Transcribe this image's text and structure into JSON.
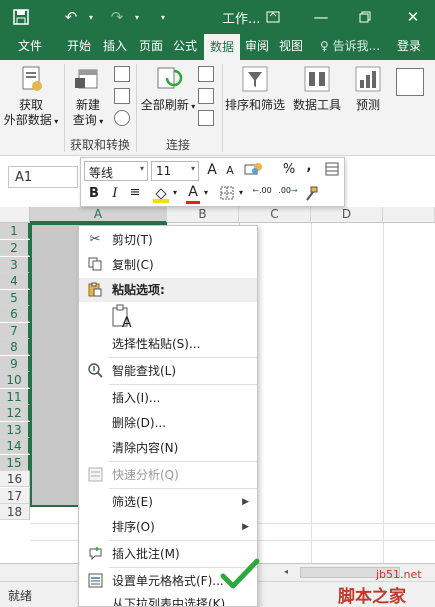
{
  "titlebar": {
    "title": "工作...",
    "save_icon": "save-icon",
    "undo_icon": "undo-icon",
    "redo_icon": "redo-icon"
  },
  "tabs": [
    {
      "label": "文件"
    },
    {
      "label": "开始"
    },
    {
      "label": "插入"
    },
    {
      "label": "页面"
    },
    {
      "label": "公式"
    },
    {
      "label": "数据"
    },
    {
      "label": "审阅"
    },
    {
      "label": "视图"
    },
    {
      "label": "告诉我..."
    },
    {
      "label": "登录"
    }
  ],
  "ribbon": {
    "get_external": "获取\n外部数据",
    "get_external_l1": "获取",
    "get_external_l2": "外部数据",
    "new_query_l1": "新建",
    "new_query_l2": "查询",
    "refresh_all": "全部刷新",
    "sort_filter": "排序和筛选",
    "data_tools": "数据工具",
    "forecast": "预测",
    "group_get_transform": "获取和转换",
    "group_connections": "连接"
  },
  "namebox": {
    "value": "A1"
  },
  "mini_toolbar": {
    "font_name": "等线",
    "font_size": "11",
    "grow_font": "A",
    "shrink_font": "A",
    "percent": "%",
    "comma": ",",
    "bold": "B",
    "italic": "I",
    "align": "≡",
    "increase_decimal": ".00",
    "decrease_decimal": ".00"
  },
  "grid": {
    "columns": [
      "A",
      "B",
      "C",
      "D"
    ],
    "rows": [
      "1",
      "2",
      "3",
      "4",
      "5",
      "6",
      "7",
      "8",
      "9",
      "10",
      "11",
      "12",
      "13",
      "14",
      "15",
      "16",
      "17",
      "18"
    ]
  },
  "context_menu": {
    "items": [
      {
        "label": "剪切(T)",
        "icon": "scissors-icon"
      },
      {
        "label": "复制(C)",
        "icon": "copy-icon"
      },
      {
        "label": "粘贴选项:",
        "icon": "clipboard-icon"
      },
      {
        "label": "选择性粘贴(S)..."
      },
      {
        "label": "智能查找(L)",
        "icon": "smart-lookup-icon"
      },
      {
        "label": "插入(I)..."
      },
      {
        "label": "删除(D)..."
      },
      {
        "label": "清除内容(N)"
      },
      {
        "label": "快速分析(Q)",
        "icon": "quick-analysis-icon"
      },
      {
        "label": "筛选(E)"
      },
      {
        "label": "排序(O)"
      },
      {
        "label": "插入批注(M)",
        "icon": "comment-icon"
      },
      {
        "label": "设置单元格格式(F)...",
        "icon": "format-cells-icon"
      },
      {
        "label": "从下拉列表中选择(K)..."
      }
    ]
  },
  "status": {
    "text": "就绪"
  },
  "watermark": {
    "line1": "jb51.net",
    "line2": "脚本之家"
  },
  "colors": {
    "excel_green": "#217346",
    "check_green": "#2ea83a"
  }
}
